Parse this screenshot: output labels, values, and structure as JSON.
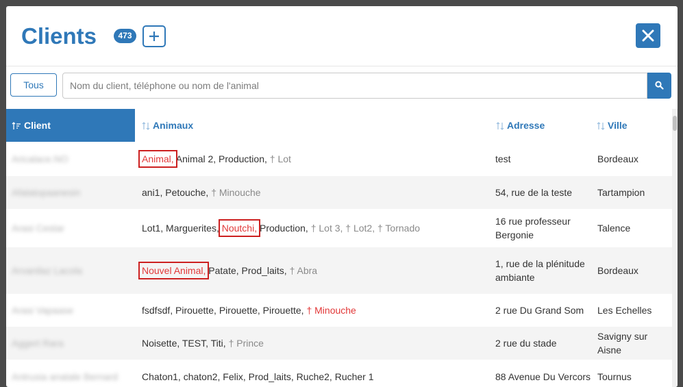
{
  "header": {
    "title": "Clients",
    "count": "473"
  },
  "search": {
    "filter_label": "Tous",
    "placeholder": "Nom du client, téléphone ou nom de l'animal"
  },
  "table": {
    "columns": {
      "client": "Client",
      "animaux": "Animaux",
      "adresse": "Adresse",
      "ville": "Ville"
    },
    "rows": [
      {
        "client": "Aricalace.NO",
        "animaux": [
          {
            "text": "Animal,",
            "style": "hl-box"
          },
          {
            "text": " Animal 2, Production, ",
            "style": ""
          },
          {
            "text": "† Lot",
            "style": "dead"
          }
        ],
        "adresse": "test",
        "ville": "Bordeaux"
      },
      {
        "client": "Afalatopaanesin",
        "animaux": [
          {
            "text": "ani1, Petouche, ",
            "style": ""
          },
          {
            "text": "† Minouche",
            "style": "dead"
          }
        ],
        "adresse": "54, rue de la teste",
        "ville": "Tartampion"
      },
      {
        "client": "Arasi Cestar",
        "animaux": [
          {
            "text": "Lot1, Marguerites, ",
            "style": ""
          },
          {
            "text": "Noutchi,",
            "style": "hl-box"
          },
          {
            "text": " Production, ",
            "style": ""
          },
          {
            "text": "† Lot 3, † Lot2, † Tornado",
            "style": "dead"
          }
        ],
        "adresse": "16 rue professeur Bergonie",
        "ville": "Talence"
      },
      {
        "client": "Arvanilaz Lacola",
        "animaux": [
          {
            "text": "Nouvel Animal,",
            "style": "hl-box"
          },
          {
            "text": " Patate, Prod_laits, ",
            "style": ""
          },
          {
            "text": "† Abra",
            "style": "dead"
          }
        ],
        "adresse": "1, rue de la plénitude ambiante",
        "ville": "Bordeaux"
      },
      {
        "client": "Arasi Vapaase",
        "animaux": [
          {
            "text": "fsdfsdf, Pirouette, Pirouette, Pirouette, ",
            "style": ""
          },
          {
            "text": "† Minouche",
            "style": "dead hl"
          }
        ],
        "adresse": "2 rue Du Grand Som",
        "ville": "Les Echelles"
      },
      {
        "client": "Aggert Rara",
        "animaux": [
          {
            "text": "Noisette, TEST, Titi, ",
            "style": ""
          },
          {
            "text": "† Prince",
            "style": "dead"
          }
        ],
        "adresse": "2 rue du stade",
        "ville": "Savigny sur Aisne"
      },
      {
        "client": "Antrusia anatale Bernard",
        "animaux": [
          {
            "text": "Chaton1, chaton2, Felix, Prod_laits, Ruche2, Rucher 1",
            "style": ""
          }
        ],
        "adresse": "88 Avenue Du Vercors",
        "ville": "Tournus"
      }
    ]
  },
  "colors": {
    "primary": "#2f78b8",
    "highlight": "#e23838",
    "dead": "#8a8a8a"
  }
}
